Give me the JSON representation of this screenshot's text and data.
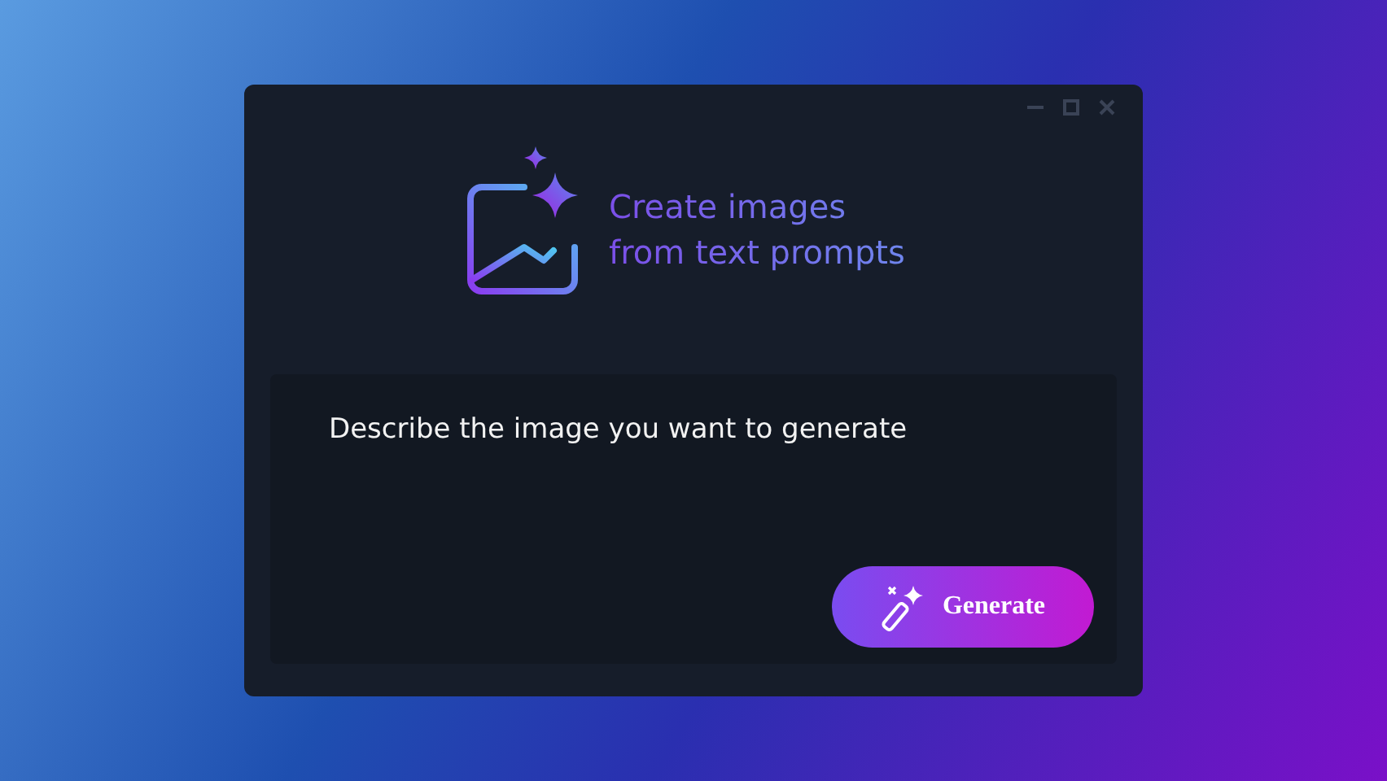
{
  "header": {
    "title_lines": [
      "Create images",
      "from text prompts"
    ]
  },
  "prompt": {
    "placeholder": "Describe the image you want to generate"
  },
  "generate_button": {
    "label": "Generate"
  }
}
